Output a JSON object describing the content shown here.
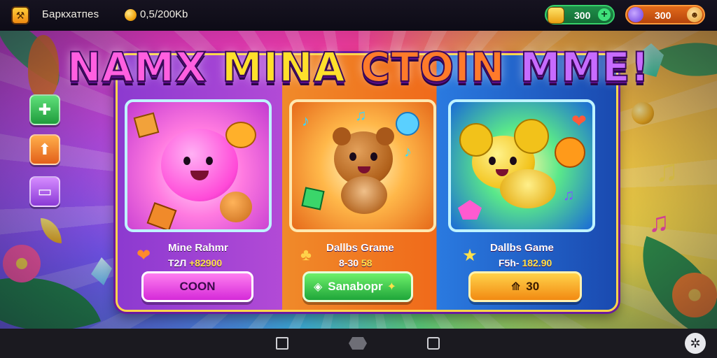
{
  "topbar": {
    "app_icon": "game-logo-icon",
    "app_title": "Баркхатпes",
    "coins_label": "0,5/200Kb",
    "gems": {
      "value": "300",
      "icon": "gem-icon",
      "plus_icon": "plus-icon"
    },
    "tokens": {
      "value": "300",
      "icon": "token-icon"
    }
  },
  "title": {
    "words": [
      "NAMX",
      "MINA",
      "CTOIN",
      "MME!"
    ]
  },
  "side_menu": [
    {
      "icon": "puzzle-icon"
    },
    {
      "icon": "upload-icon"
    },
    {
      "icon": "card-icon"
    }
  ],
  "games": [
    {
      "name": "Mine Rahmr",
      "sub_a": "T2Л",
      "sub_b": "+82900",
      "button": "COON",
      "button_icon": "",
      "icon": "heart-icon"
    },
    {
      "name": "Dallbs Grame",
      "sub_a": "8-30",
      "sub_b": "58",
      "button": "Sanabopr",
      "button_icon": "play-icon",
      "icon": "bell-icon"
    },
    {
      "name": "Dallbs Game",
      "sub_a": "F5h-",
      "sub_b": "182.90",
      "button": "30",
      "button_icon": "ticket-icon",
      "icon": "star-icon"
    }
  ],
  "colors": {
    "accent": "#ffd64a",
    "pink": "#ff5fe0",
    "green": "#36d06a",
    "orange": "#f28a12"
  },
  "bottom_nav": {
    "icons": [
      "recent-apps-icon",
      "home-icon",
      "back-icon",
      "settings-icon"
    ]
  }
}
